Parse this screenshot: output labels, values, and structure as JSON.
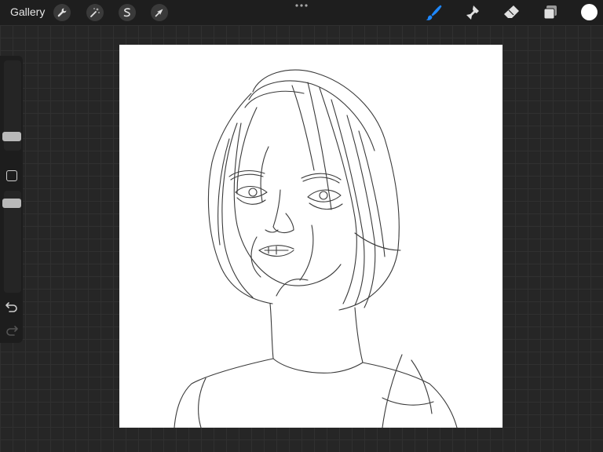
{
  "toolbar": {
    "gallery_label": "Gallery",
    "left_tools": [
      {
        "name": "wrench-icon"
      },
      {
        "name": "magic-wand-icon"
      },
      {
        "name": "selection-icon"
      },
      {
        "name": "transform-arrow-icon"
      }
    ],
    "right_tools": [
      {
        "name": "brush-icon",
        "active": true
      },
      {
        "name": "smudge-icon"
      },
      {
        "name": "eraser-icon"
      },
      {
        "name": "layers-icon"
      }
    ],
    "current_color": "#ffffff",
    "active_color": "#1e88ff"
  },
  "sidebar": {
    "controls": [
      "brush-size-slider",
      "modify-button",
      "opacity-slider",
      "undo-icon",
      "redo-icon"
    ]
  },
  "canvas": {
    "background": "#ffffff",
    "artwork": "pencil-sketch-portrait"
  }
}
